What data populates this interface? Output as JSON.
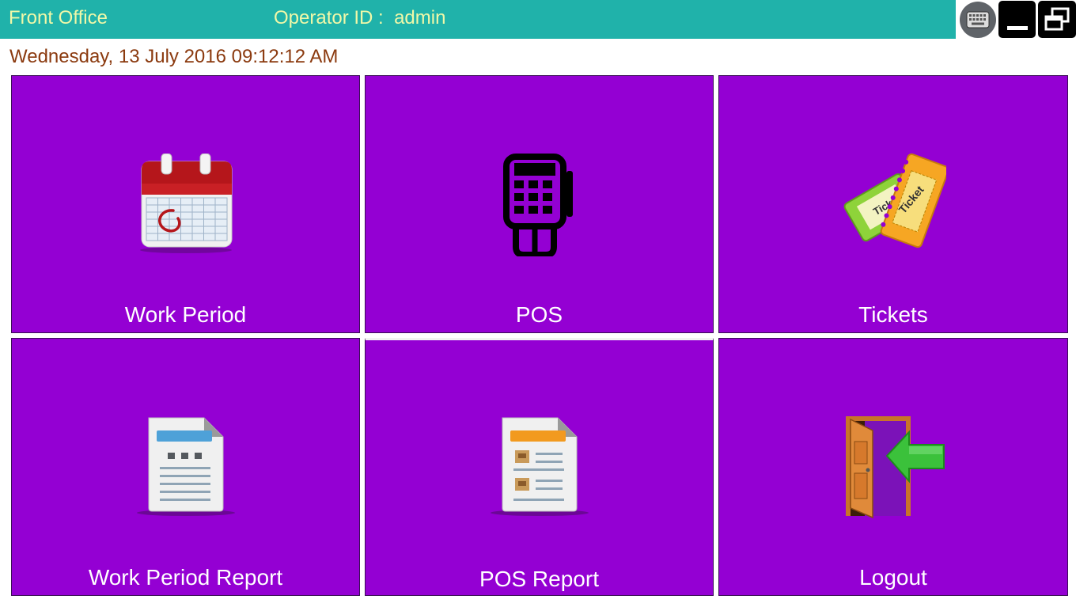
{
  "header": {
    "app_title": "Front Office",
    "operator_label": "Operator ID :",
    "operator_value": "admin"
  },
  "datetime": "Wednesday, 13 July 2016 09:12:12 AM",
  "tiles": [
    {
      "label": "Work Period",
      "icon": "calendar-icon"
    },
    {
      "label": "POS",
      "icon": "card-terminal-icon"
    },
    {
      "label": "Tickets",
      "icon": "tickets-icon"
    },
    {
      "label": "Work Period Report",
      "icon": "report-document-icon"
    },
    {
      "label": "POS Report",
      "icon": "pos-report-document-icon"
    },
    {
      "label": "Logout",
      "icon": "exit-door-icon"
    }
  ],
  "tile_ticket_text": "Ticket",
  "window_controls": [
    "keyboard-icon",
    "minimize-icon",
    "restore-icon"
  ],
  "colors": {
    "header_bg": "#20b2aa",
    "header_text": "#f0f8a8",
    "tile_bg": "#9400d3",
    "datetime_text": "#8b3a0f"
  }
}
